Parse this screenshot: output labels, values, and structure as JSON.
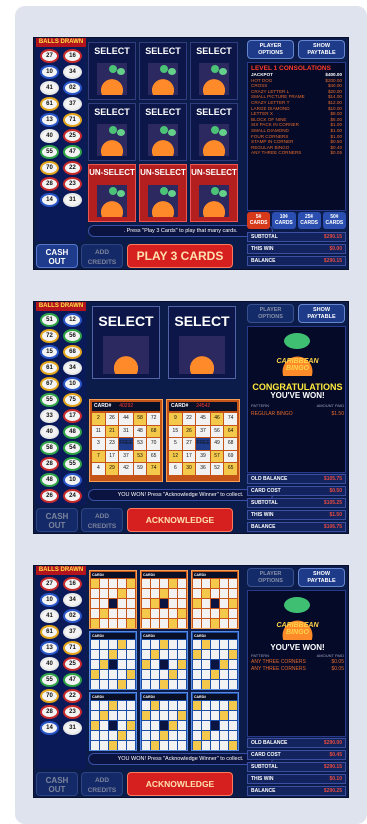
{
  "balls_header": "BALLS DRAWN",
  "screen1": {
    "ball_col1": [
      "27",
      "10",
      "41",
      "61",
      "13",
      "40",
      "55",
      "70",
      "28",
      "14"
    ],
    "ball_col2": [
      "16",
      "34",
      "02",
      "37",
      "71",
      "25",
      "47",
      "22",
      "23",
      "31"
    ],
    "select_label": "SELECT",
    "unselect_label": "UN-SELECT",
    "message": ". Press \"Play 3 Cards\" to play that many cards.",
    "cash_out": "CASH OUT",
    "add_credits": "ADD CREDITS",
    "play_button": "PLAY 3 CARDS",
    "player_options": "PLAYER OPTIONS",
    "show_paytable": "SHOW PAYTABLE",
    "paytable_title": "LEVEL 1 CONSOLATIONS",
    "paytable": [
      {
        "name": "JACKPOT",
        "value": "$400.00"
      },
      {
        "name": "HOT DOG",
        "value": "$200.00"
      },
      {
        "name": "CROSS",
        "value": "$40.00"
      },
      {
        "name": "CRAZY LETTER L",
        "value": "$20.00"
      },
      {
        "name": "SMALL PICTURE FRAME",
        "value": "$14.00"
      },
      {
        "name": "CRAZY LETTER T",
        "value": "$12.00"
      },
      {
        "name": "LARGE DIAMOND",
        "value": "$10.00"
      },
      {
        "name": "LETTER X",
        "value": "$8.00"
      },
      {
        "name": "BLOCK OF NINE",
        "value": "$5.00"
      },
      {
        "name": "SIX PACK IN CORNER",
        "value": "$1.00"
      },
      {
        "name": "SMALL DIAMOND",
        "value": "$1.00"
      },
      {
        "name": "FOUR CORNERS",
        "value": "$1.00"
      },
      {
        "name": "STAMP IN CORNER",
        "value": "$0.50"
      },
      {
        "name": "REGULAR BINGO",
        "value": "$0.40"
      },
      {
        "name": "ANY THREE CORNERS",
        "value": "$0.05"
      }
    ],
    "denoms": [
      "5¢ CARDS",
      "10¢ CARDS",
      "25¢ CARDS",
      "50¢ CARDS"
    ],
    "subtotal_label": "SUBTOTAL",
    "subtotal": "$290.15",
    "thiswin_label": "THIS WIN",
    "thiswin": "$0.00",
    "balance_label": "BALANCE",
    "balance": "$290.15"
  },
  "screen2": {
    "ball_col1": [
      "51",
      "72",
      "15",
      "61",
      "67",
      "55",
      "33",
      "40",
      "58",
      "28",
      "48",
      "26"
    ],
    "ball_col2": [
      "12",
      "56",
      "68",
      "34",
      "10",
      "75",
      "17",
      "48",
      "54",
      "55",
      "10",
      "24"
    ],
    "card1_label": "CARD#",
    "card1_num": "40292",
    "card2_label": "CARD#",
    "card2_num": "24542",
    "card1": [
      "2",
      "26",
      "44",
      "58",
      "72",
      "11",
      "21",
      "31",
      "48",
      "68",
      "3",
      "23",
      "FREE",
      "53",
      "70",
      "7",
      "17",
      "37",
      "53",
      "65",
      "4",
      "29",
      "42",
      "59",
      "74"
    ],
    "card2": [
      "9",
      "22",
      "45",
      "46",
      "74",
      "15",
      "26",
      "37",
      "56",
      "64",
      "5",
      "27",
      "FREE",
      "49",
      "68",
      "12",
      "17",
      "39",
      "57",
      "69",
      "6",
      "30",
      "36",
      "52",
      "65"
    ],
    "message": "YOU WON! Press \"Acknowledge Winner\" to collect.",
    "ack_button": "ACKNOWLEDGE WINNER",
    "logo": "CARIBBEAN BINGO",
    "congrats": "CONGRATULATIONS",
    "youwon": "YOU'VE WON!",
    "pattern_hdr": "PATTERN",
    "amount_hdr": "AMOUNT PAID",
    "win_name": "REGULAR BINGO",
    "win_value": "$1.50",
    "old_balance_label": "OLD BALANCE",
    "old_balance": "$105.75",
    "card_cost_label": "CARD COST",
    "card_cost": "$0.50",
    "subtotal": "$105.25",
    "thiswin": "$1.50",
    "balance": "$106.75"
  },
  "screen3": {
    "ball_col1": [
      "27",
      "10",
      "41",
      "61",
      "13",
      "40",
      "55",
      "70",
      "28",
      "14"
    ],
    "ball_col2": [
      "16",
      "34",
      "02",
      "37",
      "71",
      "25",
      "47",
      "22",
      "23",
      "31"
    ],
    "youwon": "YOU'VE WON!",
    "wins": [
      {
        "name": "ANY THREE CORNERS",
        "value": "$0.05"
      },
      {
        "name": "ANY THREE CORNERS",
        "value": "$0.05"
      }
    ],
    "old_balance": "$290.00",
    "card_cost": "$0.45",
    "subtotal": "$290.15",
    "thiswin": "$0.10",
    "balance": "$290.25"
  },
  "select_label": "SELECT",
  "cash_out": "CASH OUT",
  "add_credits": "ADD CREDITS",
  "player_options": "PLAYER OPTIONS",
  "show_paytable": "SHOW PAYTABLE",
  "subtotal_label": "SUBTOTAL",
  "thiswin_label": "THIS WIN",
  "balance_label": "BALANCE",
  "card_cost_label": "CARD COST",
  "old_balance_label": "OLD BALANCE",
  "card_label": "CARD#",
  "pattern_hdr": "PATTERN",
  "amount_hdr": "AMOUNT PAID",
  "ack_button": "ACKNOWLEDGE WINNER",
  "message3": "YOU WON! Press \"Acknowledge Winner\" to collect."
}
